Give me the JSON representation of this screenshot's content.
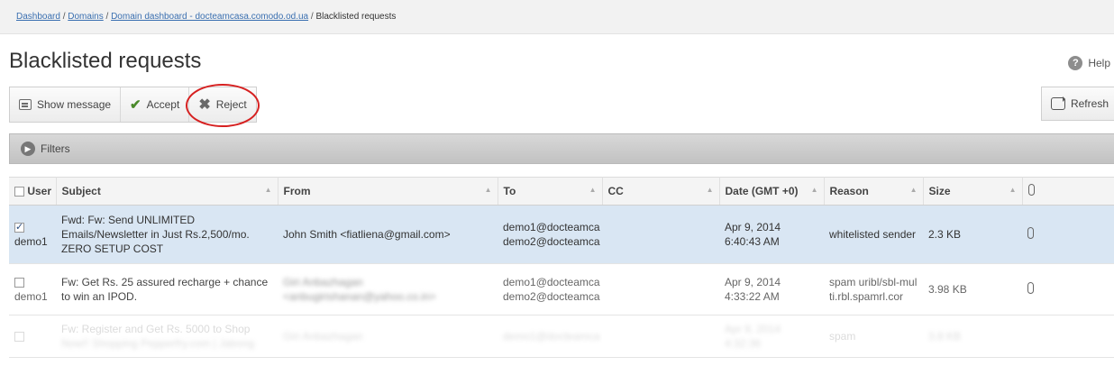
{
  "breadcrumb": {
    "items": [
      "Dashboard",
      "Domains",
      "Domain dashboard - docteamcasa.comodo.od.ua",
      "Blacklisted requests"
    ]
  },
  "page": {
    "title": "Blacklisted requests",
    "help_label": "Help"
  },
  "toolbar": {
    "show_message": "Show message",
    "accept": "Accept",
    "reject": "Reject",
    "refresh": "Refresh"
  },
  "filters": {
    "label": "Filters"
  },
  "table": {
    "headers": {
      "user": "User",
      "subject": "Subject",
      "from": "From",
      "to": "To",
      "cc": "CC",
      "date": "Date (GMT +0)",
      "reason": "Reason",
      "size": "Size"
    },
    "rows": [
      {
        "selected": true,
        "user": "demo1",
        "subject": "Fwd: Fw: Send UNLIMITED Emails/Newsletter in Just Rs.2,500/mo. ZERO SETUP COST",
        "from": "John Smith <fiatliena@gmail.com>",
        "to1": "demo1@docteamca",
        "to2": "demo2@docteamca",
        "cc": "",
        "date": "Apr 9, 2014 6:40:43 AM",
        "reason": "whitelisted sender",
        "size": "2.3 KB"
      },
      {
        "selected": false,
        "user": "demo1",
        "subject": "Fw: Get Rs. 25 assured recharge + chance to win an IPOD.",
        "from1": "Giri Anbazhagan",
        "from2": "<anbugirishanan@yahoo.co.in>",
        "to1": "demo1@docteamca",
        "to2": "demo2@docteamca",
        "cc": "",
        "date": "Apr 9, 2014 4:33:22 AM",
        "reason": "spam uribl/sbl-multi.rbl.spamrl.cor",
        "size": "3.98 KB"
      },
      {
        "selected": false,
        "user": "",
        "subject": "Fw: Register and Get Rs. 5000 to Shop",
        "subject2": "Now!! Shopping Pepperfry.com | Jabong",
        "from1": "Giri Anbazhagan",
        "to1": "demo1@docteamca",
        "date": "Apr 9, 2014 4:32:36",
        "reason": "spam",
        "size": "3.8 KB"
      }
    ]
  },
  "colors": {
    "link": "#3a6fb0",
    "selected_row": "#d9e6f3",
    "reject_ring": "#d62020",
    "accept_check": "#4a8a2a"
  }
}
